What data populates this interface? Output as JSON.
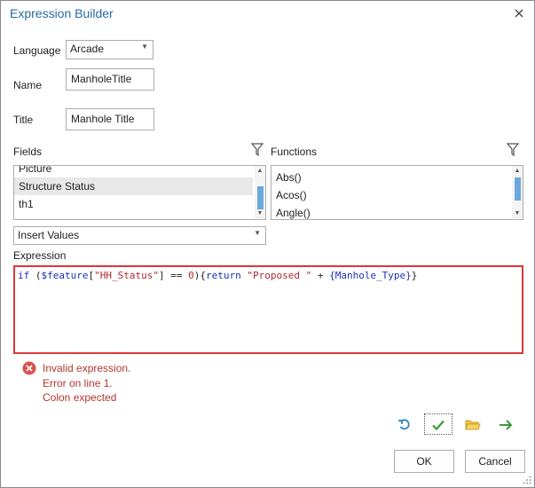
{
  "window": {
    "title": "Expression Builder"
  },
  "form": {
    "language_label": "Language",
    "language_value": "Arcade",
    "name_label": "Name",
    "name_value": "ManholeTitle",
    "title_label": "Title",
    "title_value": "Manhole Title"
  },
  "fields": {
    "label": "Fields",
    "items": [
      "Picture",
      "Structure Status",
      "th1"
    ],
    "selected_index": 1
  },
  "functions": {
    "label": "Functions",
    "items": [
      "Abs()",
      "Acos()",
      "Angle()"
    ]
  },
  "insert_values": {
    "label": "Insert Values"
  },
  "expression": {
    "label": "Expression",
    "code": {
      "if": "if",
      "open": " (",
      "feature": "$feature",
      "lbracket": "[",
      "key": "\"HH_Status\"",
      "rbracket": "]",
      "op": " == ",
      "num": "0",
      "close": ")",
      "brace_open": "{",
      "ret": "return",
      "space": " ",
      "str": "\"Proposed \"",
      "plus": " + ",
      "field": "{Manhole_Type}",
      "brace_close": "}"
    }
  },
  "error": {
    "line1": "Invalid expression.",
    "line2": "Error on line 1.",
    "line3": "Colon expected"
  },
  "buttons": {
    "ok": "OK",
    "cancel": "Cancel"
  },
  "colors": {
    "title": "#2a6aa8",
    "error": "#b3362c",
    "error_border": "#d9393a",
    "keyword": "#1f2fb0",
    "string": "#b0262d",
    "number": "#c0301c",
    "scroll_thumb": "#6aa8dd"
  },
  "icons": {
    "close": "close-icon",
    "filter": "filter-icon",
    "error": "error-icon",
    "undo": "undo-icon",
    "verify": "checkmark-icon",
    "open": "folder-open-icon",
    "run": "arrow-right-icon"
  }
}
